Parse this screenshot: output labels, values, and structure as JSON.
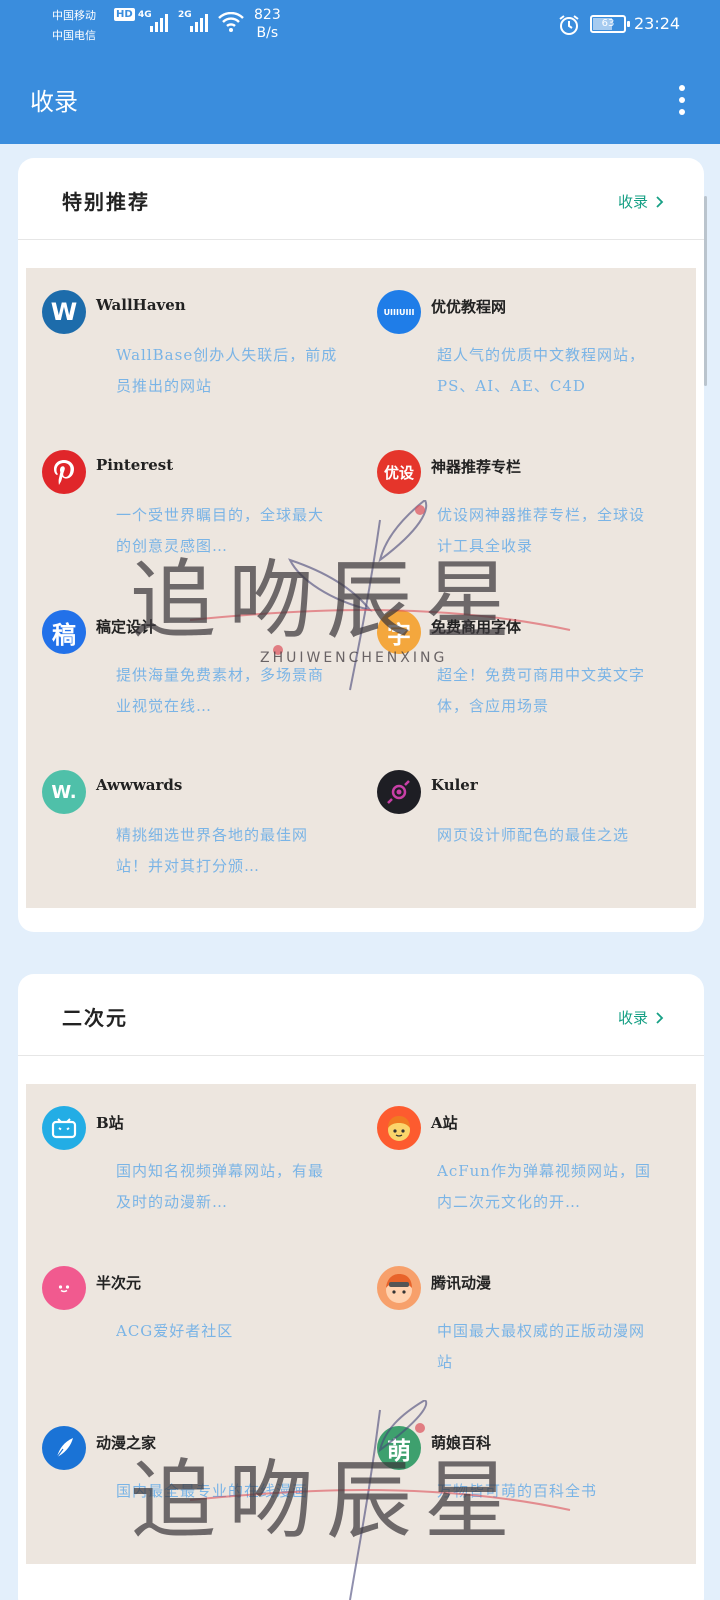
{
  "status": {
    "carrier1": "中国移动",
    "carrier2": "中国电信",
    "hd": "HD",
    "net1": "4G",
    "net2": "2G",
    "speed_value": "823",
    "speed_unit": "B/s",
    "battery": "63",
    "battery_level": 0.63,
    "time": "23:24"
  },
  "app_bar": {
    "title": "收录"
  },
  "sections": [
    {
      "title": "特别推荐",
      "more": "收录",
      "items": [
        {
          "name": "WallHaven",
          "desc": "WallBase创办人失联后，前成员推出的网站",
          "icon": "wallhaven-logo",
          "logo_text": "W",
          "color": "#1d6cab"
        },
        {
          "name": "优优教程网",
          "desc": "超人气的优质中文教程网站，PS、AI、AE、C4D",
          "icon": "uiiiuiii-logo",
          "logo_text": "UIIIUIII",
          "color": "#1f7de8"
        },
        {
          "name": "Pinterest",
          "desc": "一个受世界瞩目的，全球最大的创意灵感图…",
          "icon": "pinterest-logo",
          "logo_text": "P",
          "color": "#e0262a"
        },
        {
          "name": "神器推荐专栏",
          "desc": "优设网神器推荐专栏，全球设计工具全收录",
          "icon": "uisdc-logo",
          "logo_text": "优设",
          "color": "#e5352b"
        },
        {
          "name": "稿定设计",
          "desc": "提供海量免费素材，多场景商业视觉在线…",
          "icon": "gaoding-logo",
          "logo_text": "稿",
          "color": "#2271e9"
        },
        {
          "name": "免费商用字体",
          "desc": "超全！免费可商用中文英文字体，含应用场景",
          "icon": "font-logo",
          "logo_text": "字",
          "color": "#f4a73d"
        },
        {
          "name": "Awwwards",
          "desc": "精挑细选世界各地的最佳网站！并对其打分颁…",
          "icon": "awwwards-logo",
          "logo_text": "W.",
          "color": "#4fc0a9"
        },
        {
          "name": "Kuler",
          "desc": "网页设计师配色的最佳之选",
          "icon": "kuler-logo",
          "logo_text": "",
          "color": "#1e1e24"
        }
      ]
    },
    {
      "title": "二次元",
      "more": "收录",
      "items": [
        {
          "name": "B站",
          "desc": "国内知名视频弹幕网站，有最及时的动漫新…",
          "icon": "bilibili-logo",
          "logo_text": "",
          "color": "#23ade5"
        },
        {
          "name": "A站",
          "desc": "AcFun作为弹幕视频网站，国内二次元文化的开…",
          "icon": "acfun-logo",
          "logo_text": "",
          "color": "#fd5b2f"
        },
        {
          "name": "半次元",
          "desc": "ACG爱好者社区",
          "icon": "bcy-logo",
          "logo_text": "",
          "color": "#f15a8f"
        },
        {
          "name": "腾讯动漫",
          "desc": "中国最大最权威的正版动漫网站",
          "icon": "tencent-comic-logo",
          "logo_text": "",
          "color": "#f7a06b"
        },
        {
          "name": "动漫之家",
          "desc": "国内最全最专业的在线漫画",
          "icon": "dmzj-logo",
          "logo_text": "",
          "color": "#1a73d6"
        },
        {
          "name": "萌娘百科",
          "desc": "万物皆可萌的百科全书",
          "icon": "moegirl-logo",
          "logo_text": "萌",
          "color": "#3ea06e"
        }
      ]
    }
  ],
  "watermark": {
    "text": "追吻辰星",
    "sub": "ZHUIWENCHENXING"
  }
}
